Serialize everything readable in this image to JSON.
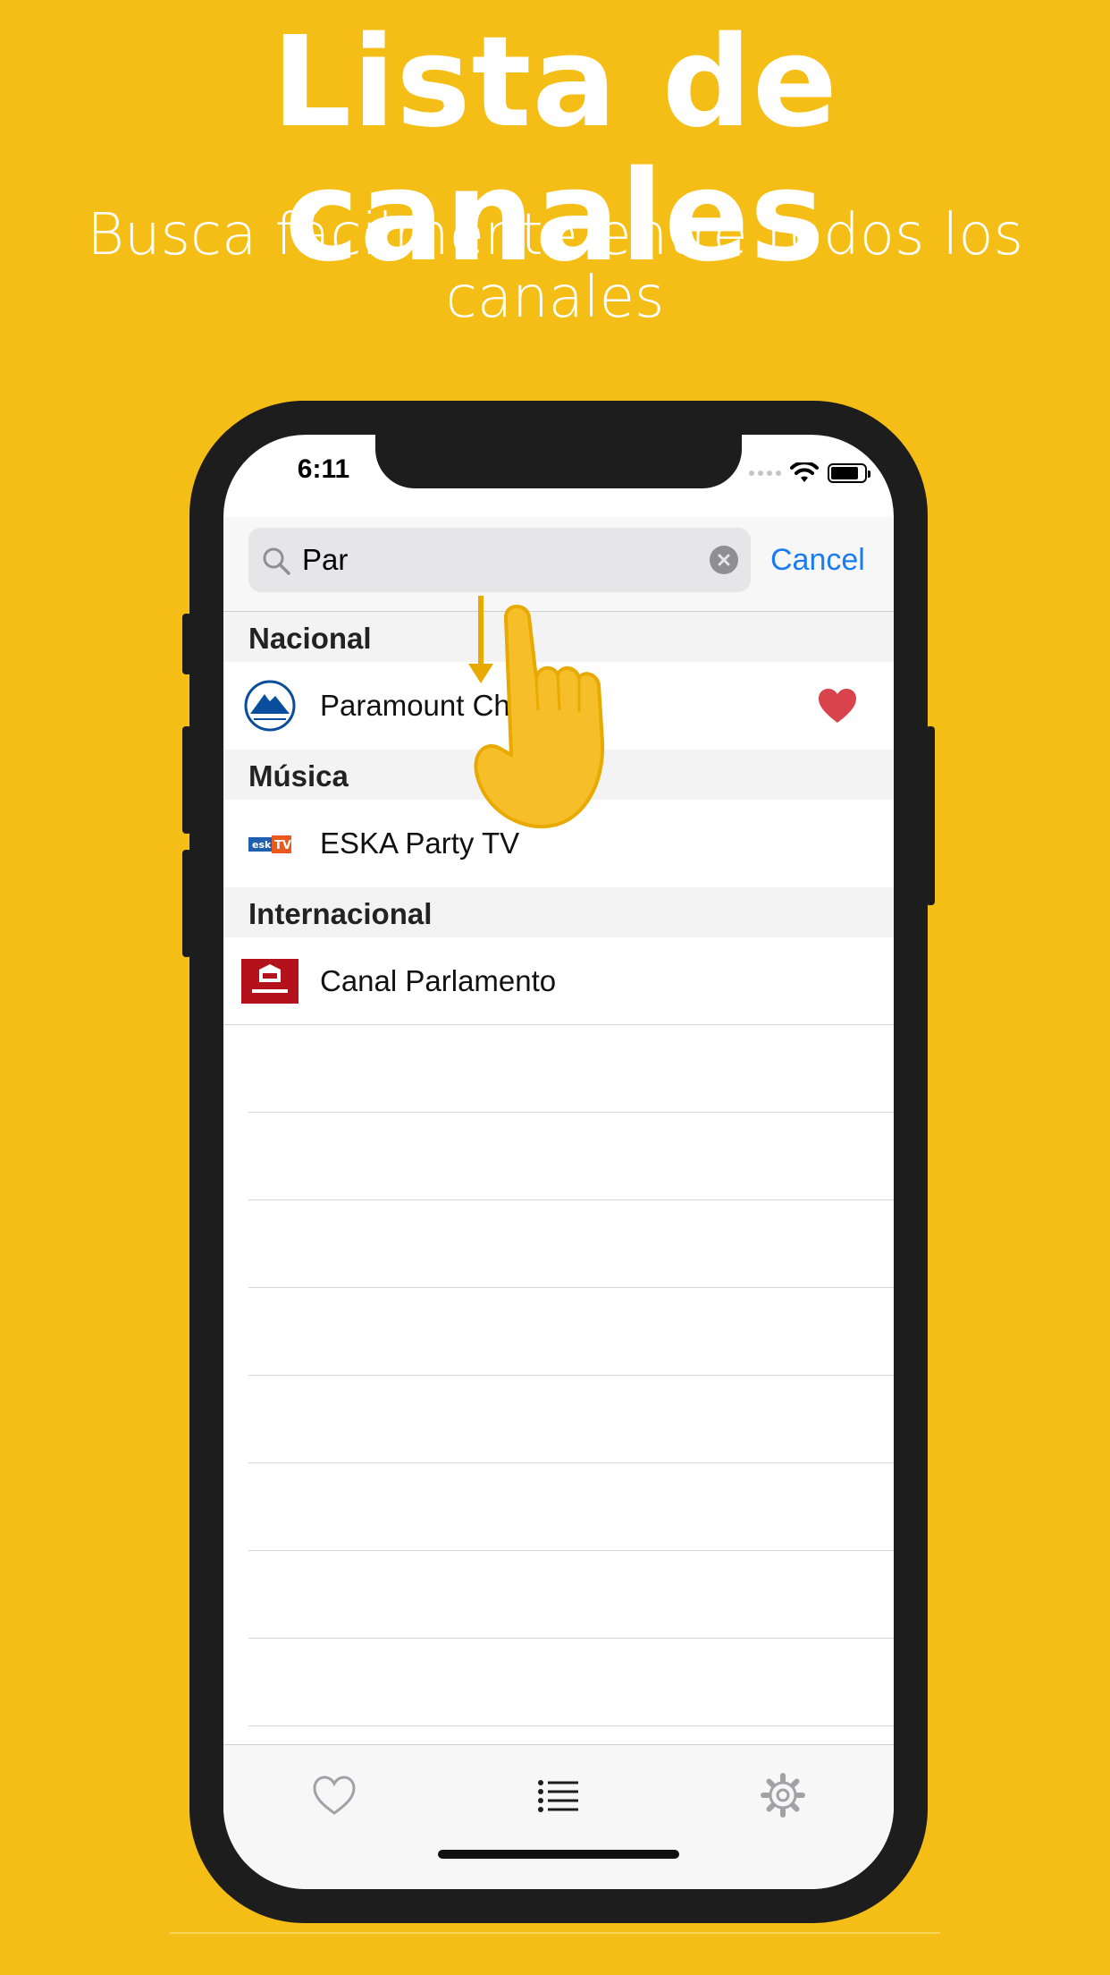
{
  "headline": "Lista de canales",
  "subheadline": "Busca fácilmente entre todos los canales",
  "status_bar": {
    "time": "6:11"
  },
  "search": {
    "query": "Par",
    "cancel_label": "Cancel"
  },
  "sections": [
    {
      "title": "Nacional",
      "items": [
        {
          "name": "Paramount Channel",
          "logo": "paramount-logo",
          "favorite": true
        }
      ]
    },
    {
      "title": "Música",
      "items": [
        {
          "name": "ESKA Party TV",
          "logo": "eska-party-tv-logo",
          "favorite": false
        }
      ]
    },
    {
      "title": "Internacional",
      "items": [
        {
          "name": "Canal Parlamento",
          "logo": "canal-parlamento-logo",
          "favorite": false
        }
      ]
    }
  ],
  "tabbar": {
    "tabs": [
      {
        "icon": "heart-icon",
        "active": false
      },
      {
        "icon": "list-icon",
        "active": true
      },
      {
        "icon": "gear-icon",
        "active": false
      }
    ]
  },
  "colors": {
    "background": "#F5BE17",
    "accent": "#1a7cf5",
    "favorite": "#d9434b",
    "phone_frame": "#1d1d1d"
  }
}
